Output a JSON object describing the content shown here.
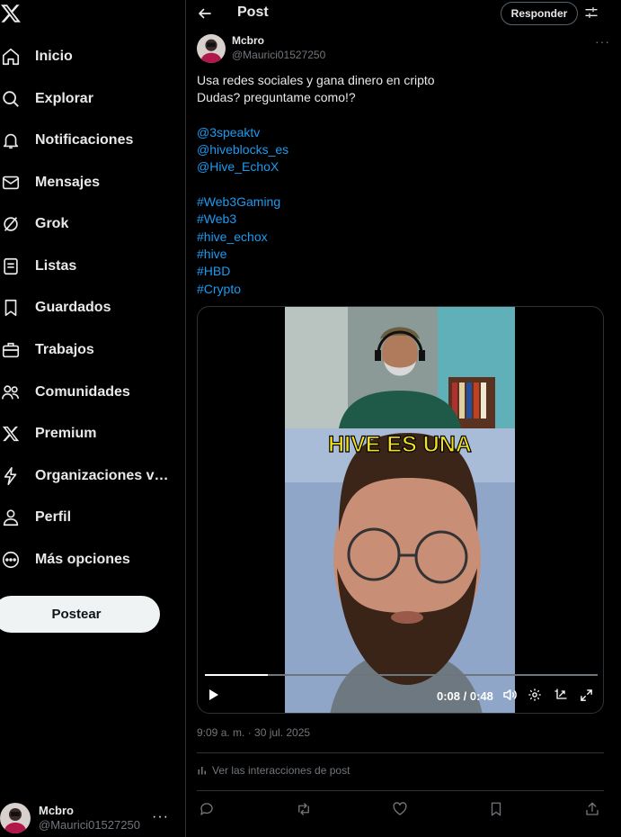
{
  "sidebar": {
    "logo": "x-logo-icon",
    "items": [
      {
        "label": "Inicio",
        "icon": "home-icon"
      },
      {
        "label": "Explorar",
        "icon": "search-icon"
      },
      {
        "label": "Notificaciones",
        "icon": "bell-icon"
      },
      {
        "label": "Mensajes",
        "icon": "mail-icon"
      },
      {
        "label": "Grok",
        "icon": "grok-icon"
      },
      {
        "label": "Listas",
        "icon": "list-icon"
      },
      {
        "label": "Guardados",
        "icon": "bookmark-icon"
      },
      {
        "label": "Trabajos",
        "icon": "briefcase-icon"
      },
      {
        "label": "Comunidades",
        "icon": "people-icon"
      },
      {
        "label": "Premium",
        "icon": "x-logo-icon"
      },
      {
        "label": "Organizaciones v…",
        "icon": "lightning-icon"
      },
      {
        "label": "Perfil",
        "icon": "person-icon"
      },
      {
        "label": "Más opciones",
        "icon": "more-circle-icon"
      }
    ],
    "post_button": "Postear",
    "account": {
      "name": "Mcbro",
      "handle": "@Maurici01527250",
      "more": "···"
    }
  },
  "header": {
    "title": "Post",
    "reply_button": "Responder"
  },
  "post": {
    "author_name": "Mcbro",
    "author_handle": "@Maurici01527250",
    "more": "···",
    "text_lines": [
      {
        "text": "Usa redes sociales y gana dinero en cripto",
        "link": false
      },
      {
        "text": "Dudas? preguntame como!?",
        "link": false
      },
      {
        "text": "",
        "link": false
      },
      {
        "text": "@3speaktv",
        "link": true
      },
      {
        "text": "@hiveblocks_es",
        "link": true
      },
      {
        "text": "@Hive_EchoX",
        "link": true
      },
      {
        "text": "",
        "link": false
      },
      {
        "text": "#Web3Gaming",
        "link": true
      },
      {
        "text": "#Web3",
        "link": true
      },
      {
        "text": "#hive_echox",
        "link": true
      },
      {
        "text": "#hive",
        "link": true
      },
      {
        "text": "#HBD",
        "link": true
      },
      {
        "text": "#Crypto",
        "link": true
      }
    ],
    "video": {
      "caption": "HIVE ES UNA",
      "time": "0:08 / 0:48",
      "progress": 0.16
    },
    "timestamp": "9:09 a. m. · 30 jul. 2025",
    "interactions_link": "Ver las interacciones de post"
  },
  "colors": {
    "accent": "#1d9bf0",
    "background": "#000000",
    "muted": "#71767b"
  }
}
